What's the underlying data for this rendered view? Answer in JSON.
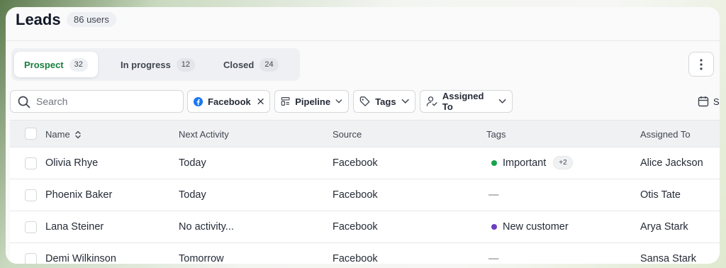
{
  "page": {
    "title": "Leads",
    "user_count": "86 users"
  },
  "tabs": [
    {
      "label": "Prospect",
      "count": "32",
      "active": true
    },
    {
      "label": "In progress",
      "count": "12",
      "active": false
    },
    {
      "label": "Closed",
      "count": "24",
      "active": false
    }
  ],
  "more_icon": "more-vertical-icon",
  "search": {
    "placeholder": "Search",
    "value": ""
  },
  "filters": {
    "facebook": {
      "label": "Facebook",
      "icon": "facebook-icon",
      "color": "#1877F2"
    },
    "pipeline": {
      "label": "Pipeline",
      "icon": "pipeline-icon"
    },
    "tags": {
      "label": "Tags",
      "icon": "tag-icon"
    },
    "assigned": {
      "label": "Assigned To",
      "icon": "user-check-icon"
    },
    "date_icon": "calendar-icon",
    "date_partial": "S"
  },
  "table": {
    "columns": {
      "name": "Name",
      "next_activity": "Next Activity",
      "source": "Source",
      "tags": "Tags",
      "assigned_to": "Assigned To"
    },
    "rows": [
      {
        "name": "Olivia Rhye",
        "next_activity": "Today",
        "source": "Facebook",
        "tag": "Important",
        "tag_color": "#17a34a",
        "tag_extra": "+2",
        "assigned_to": "Alice Jackson"
      },
      {
        "name": "Phoenix Baker",
        "next_activity": "Today",
        "source": "Facebook",
        "tag": "—",
        "tag_color": "",
        "tag_extra": "",
        "assigned_to": "Otis Tate"
      },
      {
        "name": "Lana Steiner",
        "next_activity": "No activity...",
        "source": "Facebook",
        "tag": "New customer",
        "tag_color": "#6b3fbf",
        "tag_extra": "",
        "assigned_to": "Arya Stark"
      },
      {
        "name": "Demi Wilkinson",
        "next_activity": "Tomorrow",
        "source": "Facebook",
        "tag": "—",
        "tag_color": "",
        "tag_extra": "",
        "assigned_to": "Sansa Stark"
      }
    ]
  },
  "colors": {
    "accent": "#17803d",
    "important_dot": "#17a34a",
    "new_customer_dot": "#6b3fbf"
  }
}
